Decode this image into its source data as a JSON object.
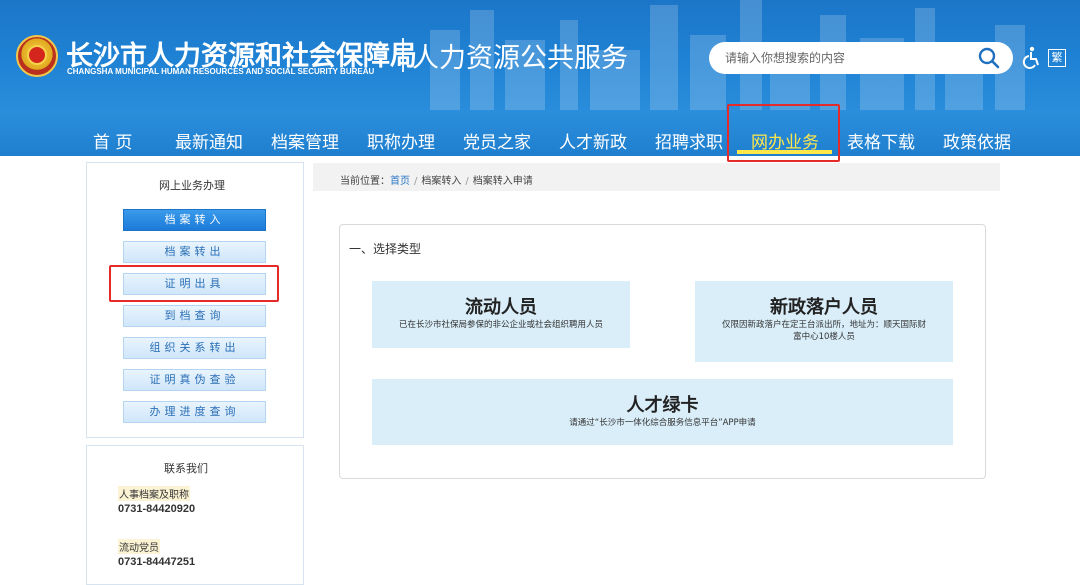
{
  "header": {
    "title_cn": "长沙市人力资源和社会保障局",
    "title_en": "CHANGSHA MUNICIPAL HUMAN RESOURCES AND SOCIAL SECURITY BUREAU",
    "subtitle": "人力资源公共服务",
    "search_placeholder": "请输入你想搜索的内容",
    "trad_label": "繁"
  },
  "nav": {
    "items": [
      "首 页",
      "最新通知",
      "档案管理",
      "职称办理",
      "党员之家",
      "人才新政",
      "招聘求职",
      "网办业务",
      "表格下载",
      "政策依据"
    ],
    "active": "网办业务"
  },
  "sidebar": {
    "title": "网上业务办理",
    "buttons": [
      "档案转入",
      "档案转出",
      "证明出具",
      "到档查询",
      "组织关系转出",
      "证明真伪查验",
      "办理进度查询"
    ],
    "active": "档案转入"
  },
  "contact": {
    "title": "联系我们",
    "entries": [
      {
        "label": "人事档案及职称",
        "phone": "0731-84420920"
      },
      {
        "label": "流动党员",
        "phone": "0731-84447251"
      }
    ]
  },
  "breadcrumb": {
    "prefix": "当前位置：",
    "items": [
      "首页",
      "档案转入",
      "档案转入申请"
    ]
  },
  "main": {
    "section_title": "一、选择类型",
    "cards": [
      {
        "title": "流动人员",
        "desc": "已在长沙市社保局参保的非公企业或社会组织聘用人员"
      },
      {
        "title": "新政落户人员",
        "desc": "仅限因新政落户在定王台派出所，地址为：顺天国际财富中心10楼人员"
      },
      {
        "title": "人才绿卡",
        "desc": "请通过“长沙市一体化综合服务信息平台”APP申请"
      }
    ]
  },
  "colors": {
    "header_blue": "#1f82d4",
    "nav_active": "#ffe74a",
    "highlight_red": "#e52a2a",
    "card_bg": "#d9eef9"
  }
}
